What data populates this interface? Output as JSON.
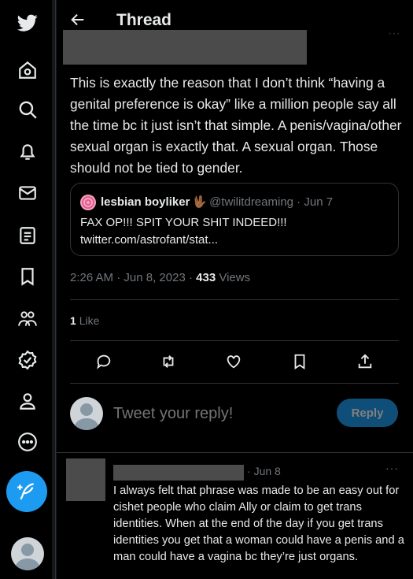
{
  "header": {
    "title": "Thread"
  },
  "sidebar": {
    "items": [
      {
        "icon": "twitter-bird-icon"
      },
      {
        "icon": "home-icon"
      },
      {
        "icon": "search-icon"
      },
      {
        "icon": "notifications-bell-icon"
      },
      {
        "icon": "messages-envelope-icon"
      },
      {
        "icon": "lists-icon"
      },
      {
        "icon": "bookmark-icon"
      },
      {
        "icon": "communities-icon"
      },
      {
        "icon": "verified-badge-icon"
      },
      {
        "icon": "profile-icon"
      },
      {
        "icon": "more-circle-icon"
      }
    ],
    "compose_icon": "compose-feather-icon"
  },
  "tweet": {
    "text": "This is exactly the reason that I don’t think “having a genital preference is okay” like a million people say all the time bc it just isn’t that simple. A penis/vagina/other sexual organ is exactly that. A sexual organ. Those should not be tied to gender.",
    "quote": {
      "name": "lesbian boyliker",
      "emoji": "🖖🏾",
      "handle": "@twilitdreaming",
      "date": "Jun 7",
      "text": "FAX OP!!! SPIT YOUR SHIT INDEED!!!",
      "link": "twitter.com/astrofant/stat..."
    },
    "time": "2:26 AM",
    "date": "Jun 8, 2023",
    "views_count": "433",
    "views_label": "Views",
    "likes_count": "1",
    "likes_label": "Like"
  },
  "reply_box": {
    "placeholder": "Tweet your reply!",
    "button_label": "Reply"
  },
  "reply": {
    "date": "Jun 8",
    "more": "···",
    "text": "I always felt that phrase was made to be an easy out for cishet people who claim Ally or claim to get trans identities. When at the end of the day if you get trans identities you get that a woman could have a penis and a man could have a vagina bc they’re just organs."
  },
  "colors": {
    "accent": "#1d9bf0",
    "reply_button_disabled": "#0f4e78",
    "background": "#000000",
    "text": "#e7e9ea",
    "muted": "#71767b",
    "border": "#2f3336"
  }
}
